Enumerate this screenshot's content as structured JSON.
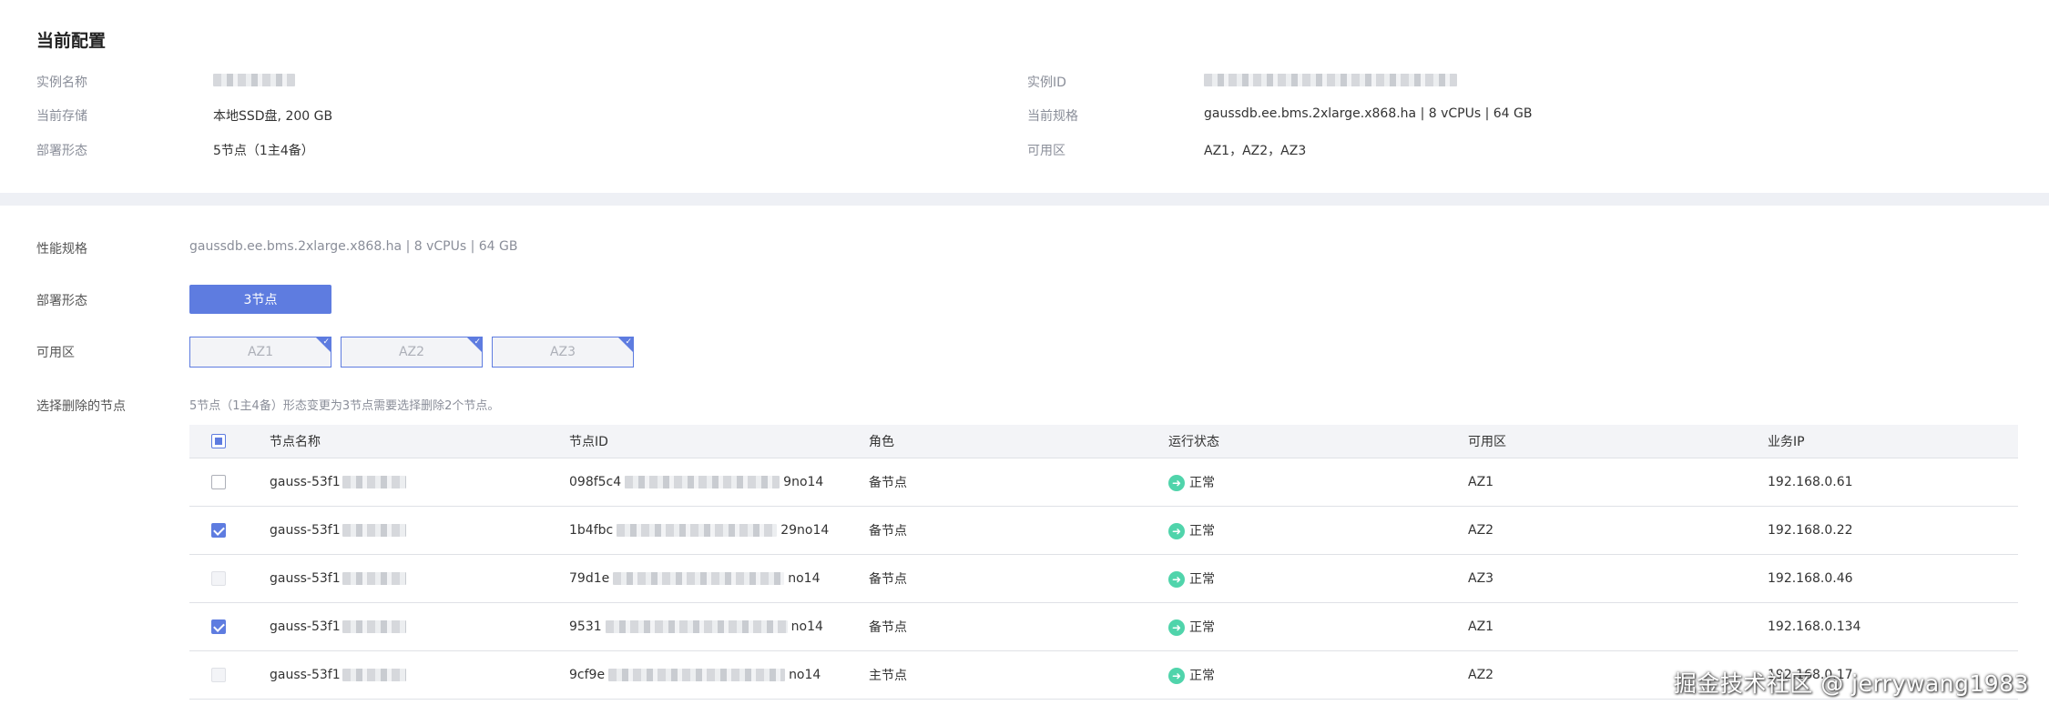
{
  "current_config": {
    "title": "当前配置",
    "fields": {
      "instance_name_label": "实例名称",
      "instance_id_label": "实例ID",
      "storage_label": "当前存储",
      "storage_value": "本地SSD盘, 200 GB",
      "spec_label": "当前规格",
      "spec_value": "gaussdb.ee.bms.2xlarge.x868.ha | 8 vCPUs | 64 GB",
      "deploy_label": "部署形态",
      "deploy_value": "5节点（1主4备）",
      "az_label": "可用区",
      "az_value": "AZ1，AZ2，AZ3"
    }
  },
  "change_form": {
    "spec_label": "性能规格",
    "spec_value": "gaussdb.ee.bms.2xlarge.x868.ha | 8 vCPUs | 64 GB",
    "deploy_label": "部署形态",
    "deploy_option": "3节点",
    "az_label": "可用区",
    "az_options": [
      "AZ1",
      "AZ2",
      "AZ3"
    ],
    "select_label": "选择删除的节点",
    "hint": "5节点（1主4备）形态变更为3节点需要选择删除2个节点。"
  },
  "table": {
    "headers": [
      "节点名称",
      "节点ID",
      "角色",
      "运行状态",
      "可用区",
      "业务IP"
    ],
    "rows": [
      {
        "name": "gauss-53f1",
        "id_start": "098f5c4",
        "id_end": "9no14",
        "role": "备节点",
        "status": "正常",
        "az": "AZ1",
        "ip": "192.168.0.61",
        "checked": false
      },
      {
        "name": "gauss-53f1",
        "id_start": "1b4fbc",
        "id_end": "29no14",
        "role": "备节点",
        "status": "正常",
        "az": "AZ2",
        "ip": "192.168.0.22",
        "checked": true
      },
      {
        "name": "gauss-53f1",
        "id_start": "79d1e",
        "id_end": "no14",
        "role": "备节点",
        "status": "正常",
        "az": "AZ3",
        "ip": "192.168.0.46",
        "checked": false
      },
      {
        "name": "gauss-53f1",
        "id_start": "9531",
        "id_end": "no14",
        "role": "备节点",
        "status": "正常",
        "az": "AZ1",
        "ip": "192.168.0.134",
        "checked": true
      },
      {
        "name": "gauss-53f1",
        "id_start": "9cf9e",
        "id_end": "no14",
        "role": "主节点",
        "status": "正常",
        "az": "AZ2",
        "ip": "192.168.0.17",
        "checked": false
      }
    ]
  },
  "watermark": "掘金技术社区 @ jerrywang1983",
  "colors": {
    "accent": "#5e7ce0",
    "status_ok": "#50d4ab",
    "muted": "#8a8e99"
  }
}
